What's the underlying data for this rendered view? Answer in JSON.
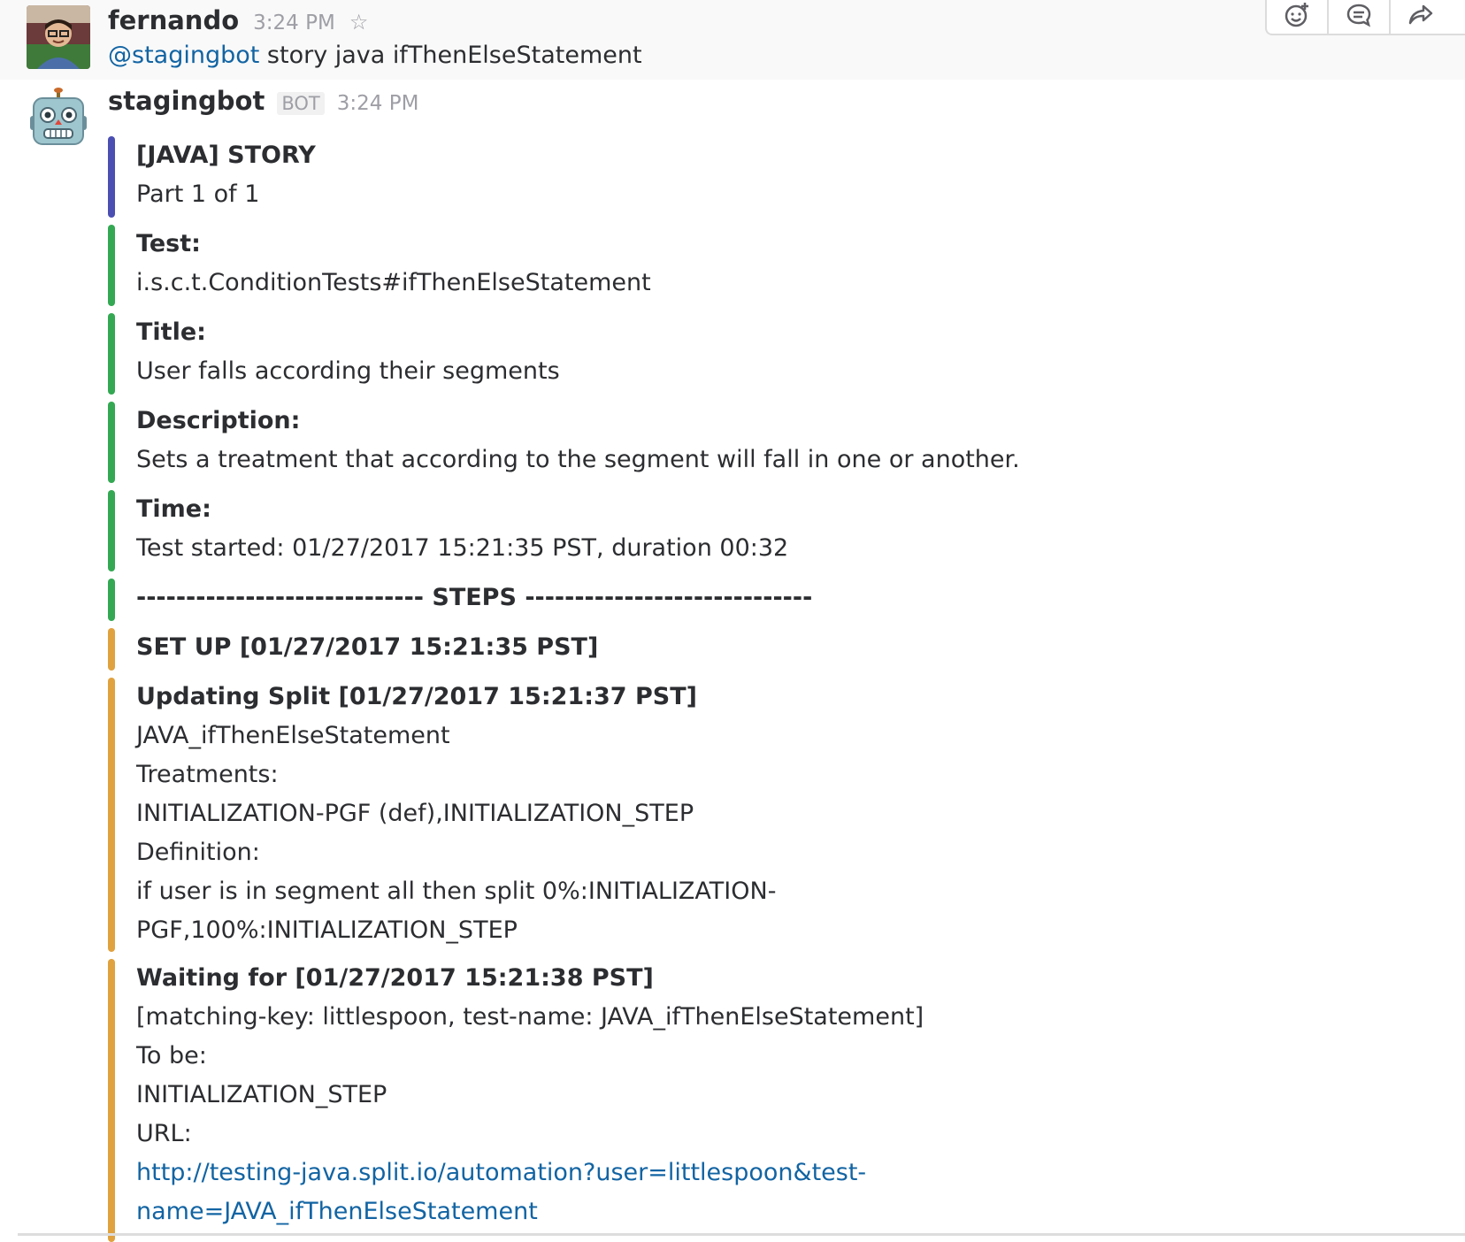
{
  "messages": {
    "user": {
      "sender": "fernando",
      "time": "3:24 PM",
      "mention": "@stagingbot",
      "text": " story java ifThenElseStatement"
    },
    "bot": {
      "sender": "stagingbot",
      "badge": "BOT",
      "time": "3:24 PM"
    }
  },
  "icons": {
    "star": "star-icon",
    "reaction": "add-reaction-icon",
    "comment": "comment-icon",
    "share": "share-icon"
  },
  "colors": {
    "blue_bar": "#4b4fb2",
    "green_bar": "#34a853",
    "orange_bar": "#e0a23f",
    "link": "#1264a3"
  },
  "attachments": {
    "header": {
      "title": "[JAVA] STORY",
      "subtitle": "Part 1 of 1"
    },
    "test": {
      "label": "Test:",
      "value": "i.s.c.t.ConditionTests#ifThenElseStatement"
    },
    "title": {
      "label": "Title:",
      "value": "User falls according their segments"
    },
    "description": {
      "label": "Description:",
      "value": "Sets a treatment that according to the segment will fall in one or another."
    },
    "time": {
      "label": "Time:",
      "value": "Test started: 01/27/2017 15:21:35 PST, duration 00:32"
    },
    "steps": {
      "label": "----------------------------- STEPS -----------------------------"
    },
    "setup": {
      "label": "SET UP [01/27/2017 15:21:35 PST]"
    },
    "updating": {
      "label": "Updating Split [01/27/2017 15:21:37 PST]",
      "lines": [
        "JAVA_ifThenElseStatement",
        "Treatments:",
        "INITIALIZATION-PGF (def),INITIALIZATION_STEP",
        "Definition:",
        "if user is in segment all then split 0%:INITIALIZATION-",
        "PGF,100%:INITIALIZATION_STEP"
      ]
    },
    "waiting": {
      "label": "Waiting for [01/27/2017 15:21:38 PST]",
      "lines": [
        "[matching-key: littlespoon, test-name: JAVA_ifThenElseStatement]",
        "To be:",
        "INITIALIZATION_STEP",
        "URL:"
      ],
      "url_lines": [
        "http://testing-java.split.io/automation?user=littlespoon&test-",
        "name=JAVA_ifThenElseStatement"
      ]
    }
  }
}
